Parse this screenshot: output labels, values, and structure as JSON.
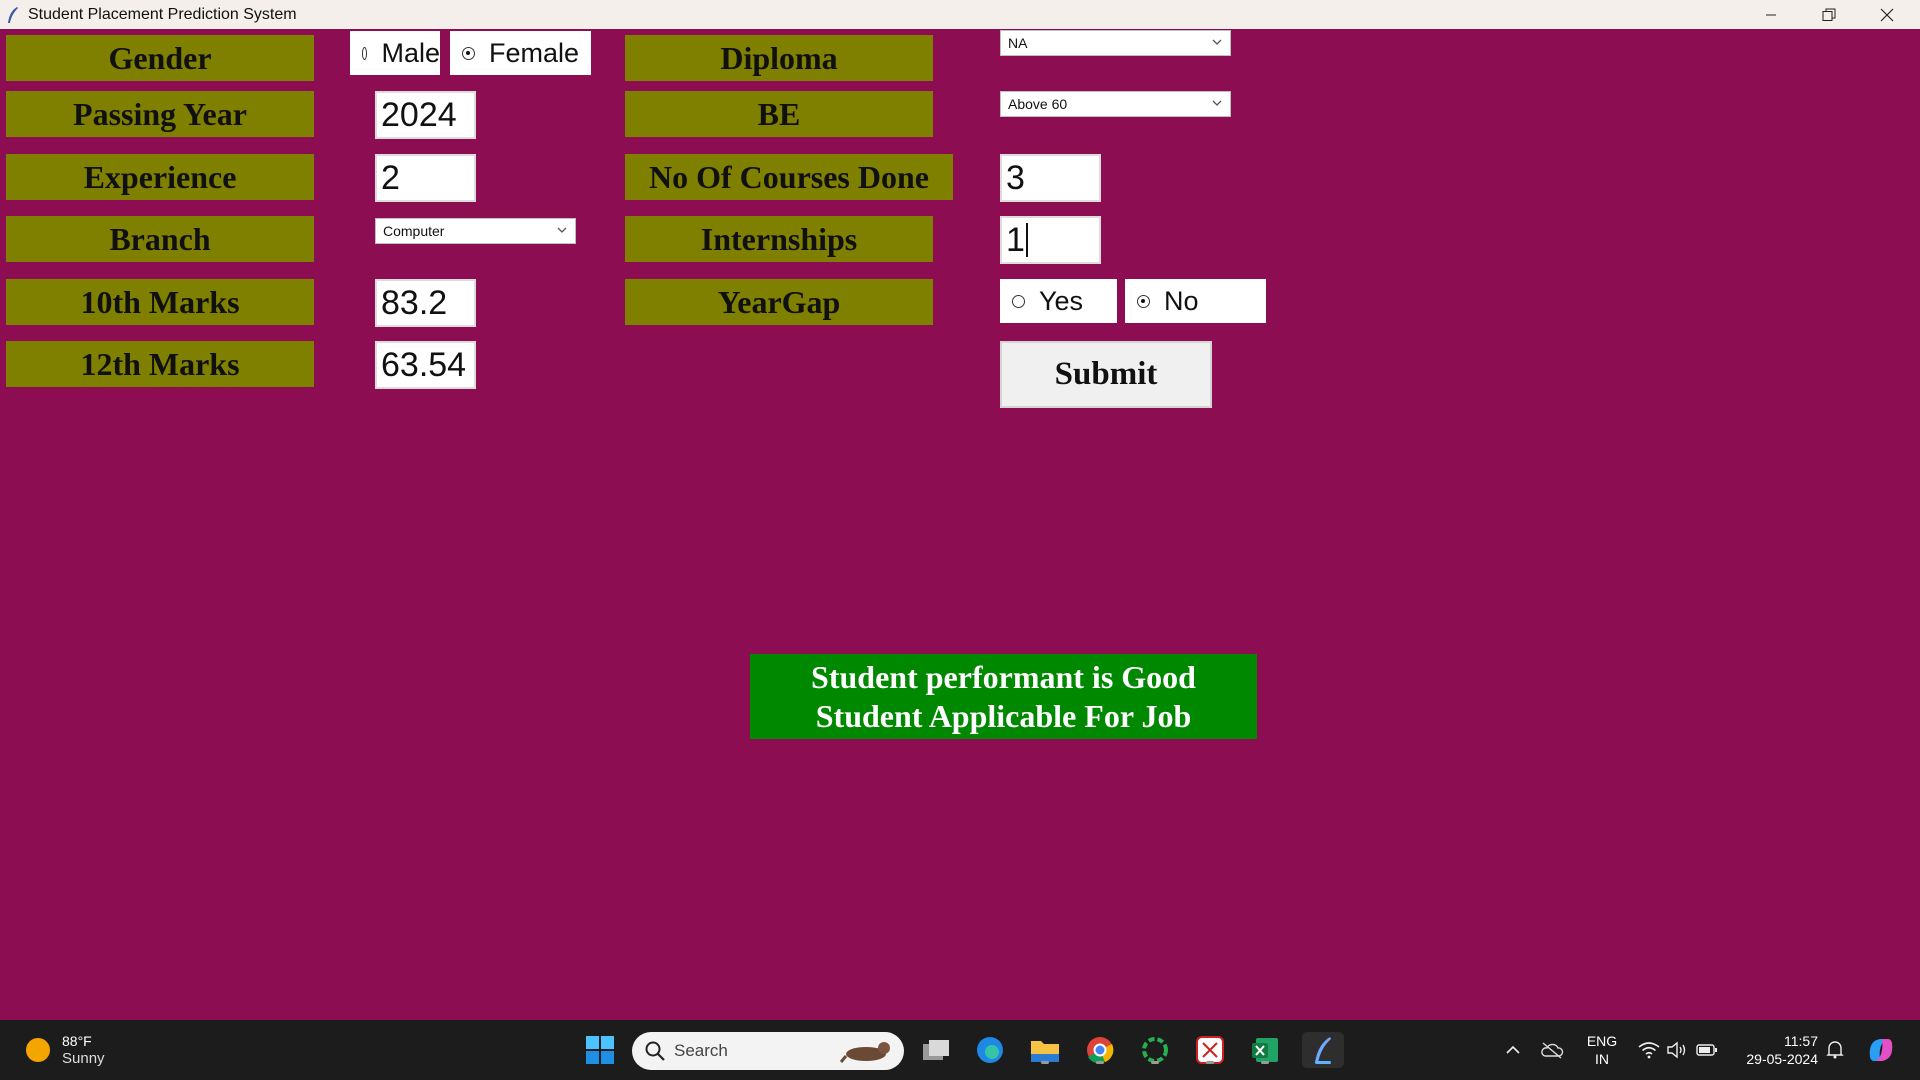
{
  "window": {
    "title": "Student Placement Prediction System"
  },
  "form": {
    "gender": {
      "label": "Gender",
      "options": [
        "Male",
        "Female"
      ],
      "selected": "Female"
    },
    "passing_year": {
      "label": "Passing Year",
      "value": "2024"
    },
    "experience": {
      "label": "Experience",
      "value": "2"
    },
    "branch": {
      "label": "Branch",
      "value": "Computer"
    },
    "tenth_marks": {
      "label": "10th Marks",
      "value": "83.2"
    },
    "twelfth_marks": {
      "label": "12th Marks",
      "value": "63.54"
    },
    "diploma": {
      "label": "Diploma",
      "value": "NA"
    },
    "be": {
      "label": "BE",
      "value": "Above 60"
    },
    "courses_done": {
      "label": "No Of Courses Done",
      "value": "3"
    },
    "internships": {
      "label": "Internships",
      "value": "1"
    },
    "year_gap": {
      "label": "YearGap",
      "options": [
        "Yes",
        "No"
      ],
      "selected": "No"
    },
    "submit_label": "Submit"
  },
  "result": {
    "line1": "Student performant is Good",
    "line2": "Student Applicable For Job",
    "color": "#008800"
  },
  "colors": {
    "background": "#8d0d52",
    "label_bg": "#7f7f00"
  },
  "taskbar": {
    "weather_temp": "88°F",
    "weather_desc": "Sunny",
    "search_label": "Search",
    "lang_top": "ENG",
    "lang_bottom": "IN",
    "time": "11:57",
    "date": "29-05-2024"
  }
}
